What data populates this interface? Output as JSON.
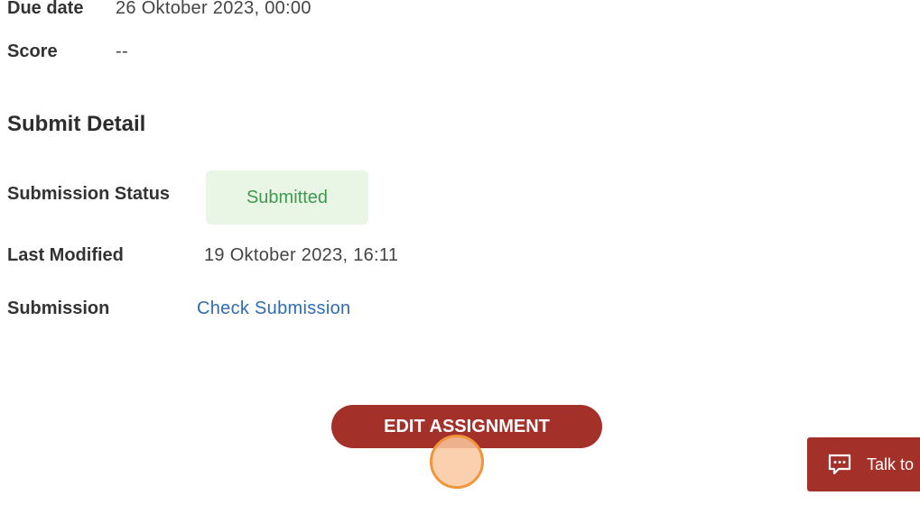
{
  "assignment": {
    "due_date_label": "Due date",
    "due_date_value": "26 Oktober 2023, 00:00",
    "score_label": "Score",
    "score_value": "--"
  },
  "submit_detail": {
    "title": "Submit Detail",
    "status_label": "Submission Status",
    "status_value": "Submitted",
    "last_modified_label": "Last Modified",
    "last_modified_value": "19 Oktober 2023, 16:11",
    "submission_label": "Submission",
    "submission_link": "Check Submission"
  },
  "actions": {
    "edit_assignment": "EDIT ASSIGNMENT"
  },
  "chat_widget": {
    "label": "Talk to",
    "icon": "chat-bubble-icon"
  },
  "colors": {
    "brand": "#a4302a",
    "status_bg": "#e9f6e6",
    "status_text": "#3d9a4e",
    "link": "#2f6db0"
  }
}
